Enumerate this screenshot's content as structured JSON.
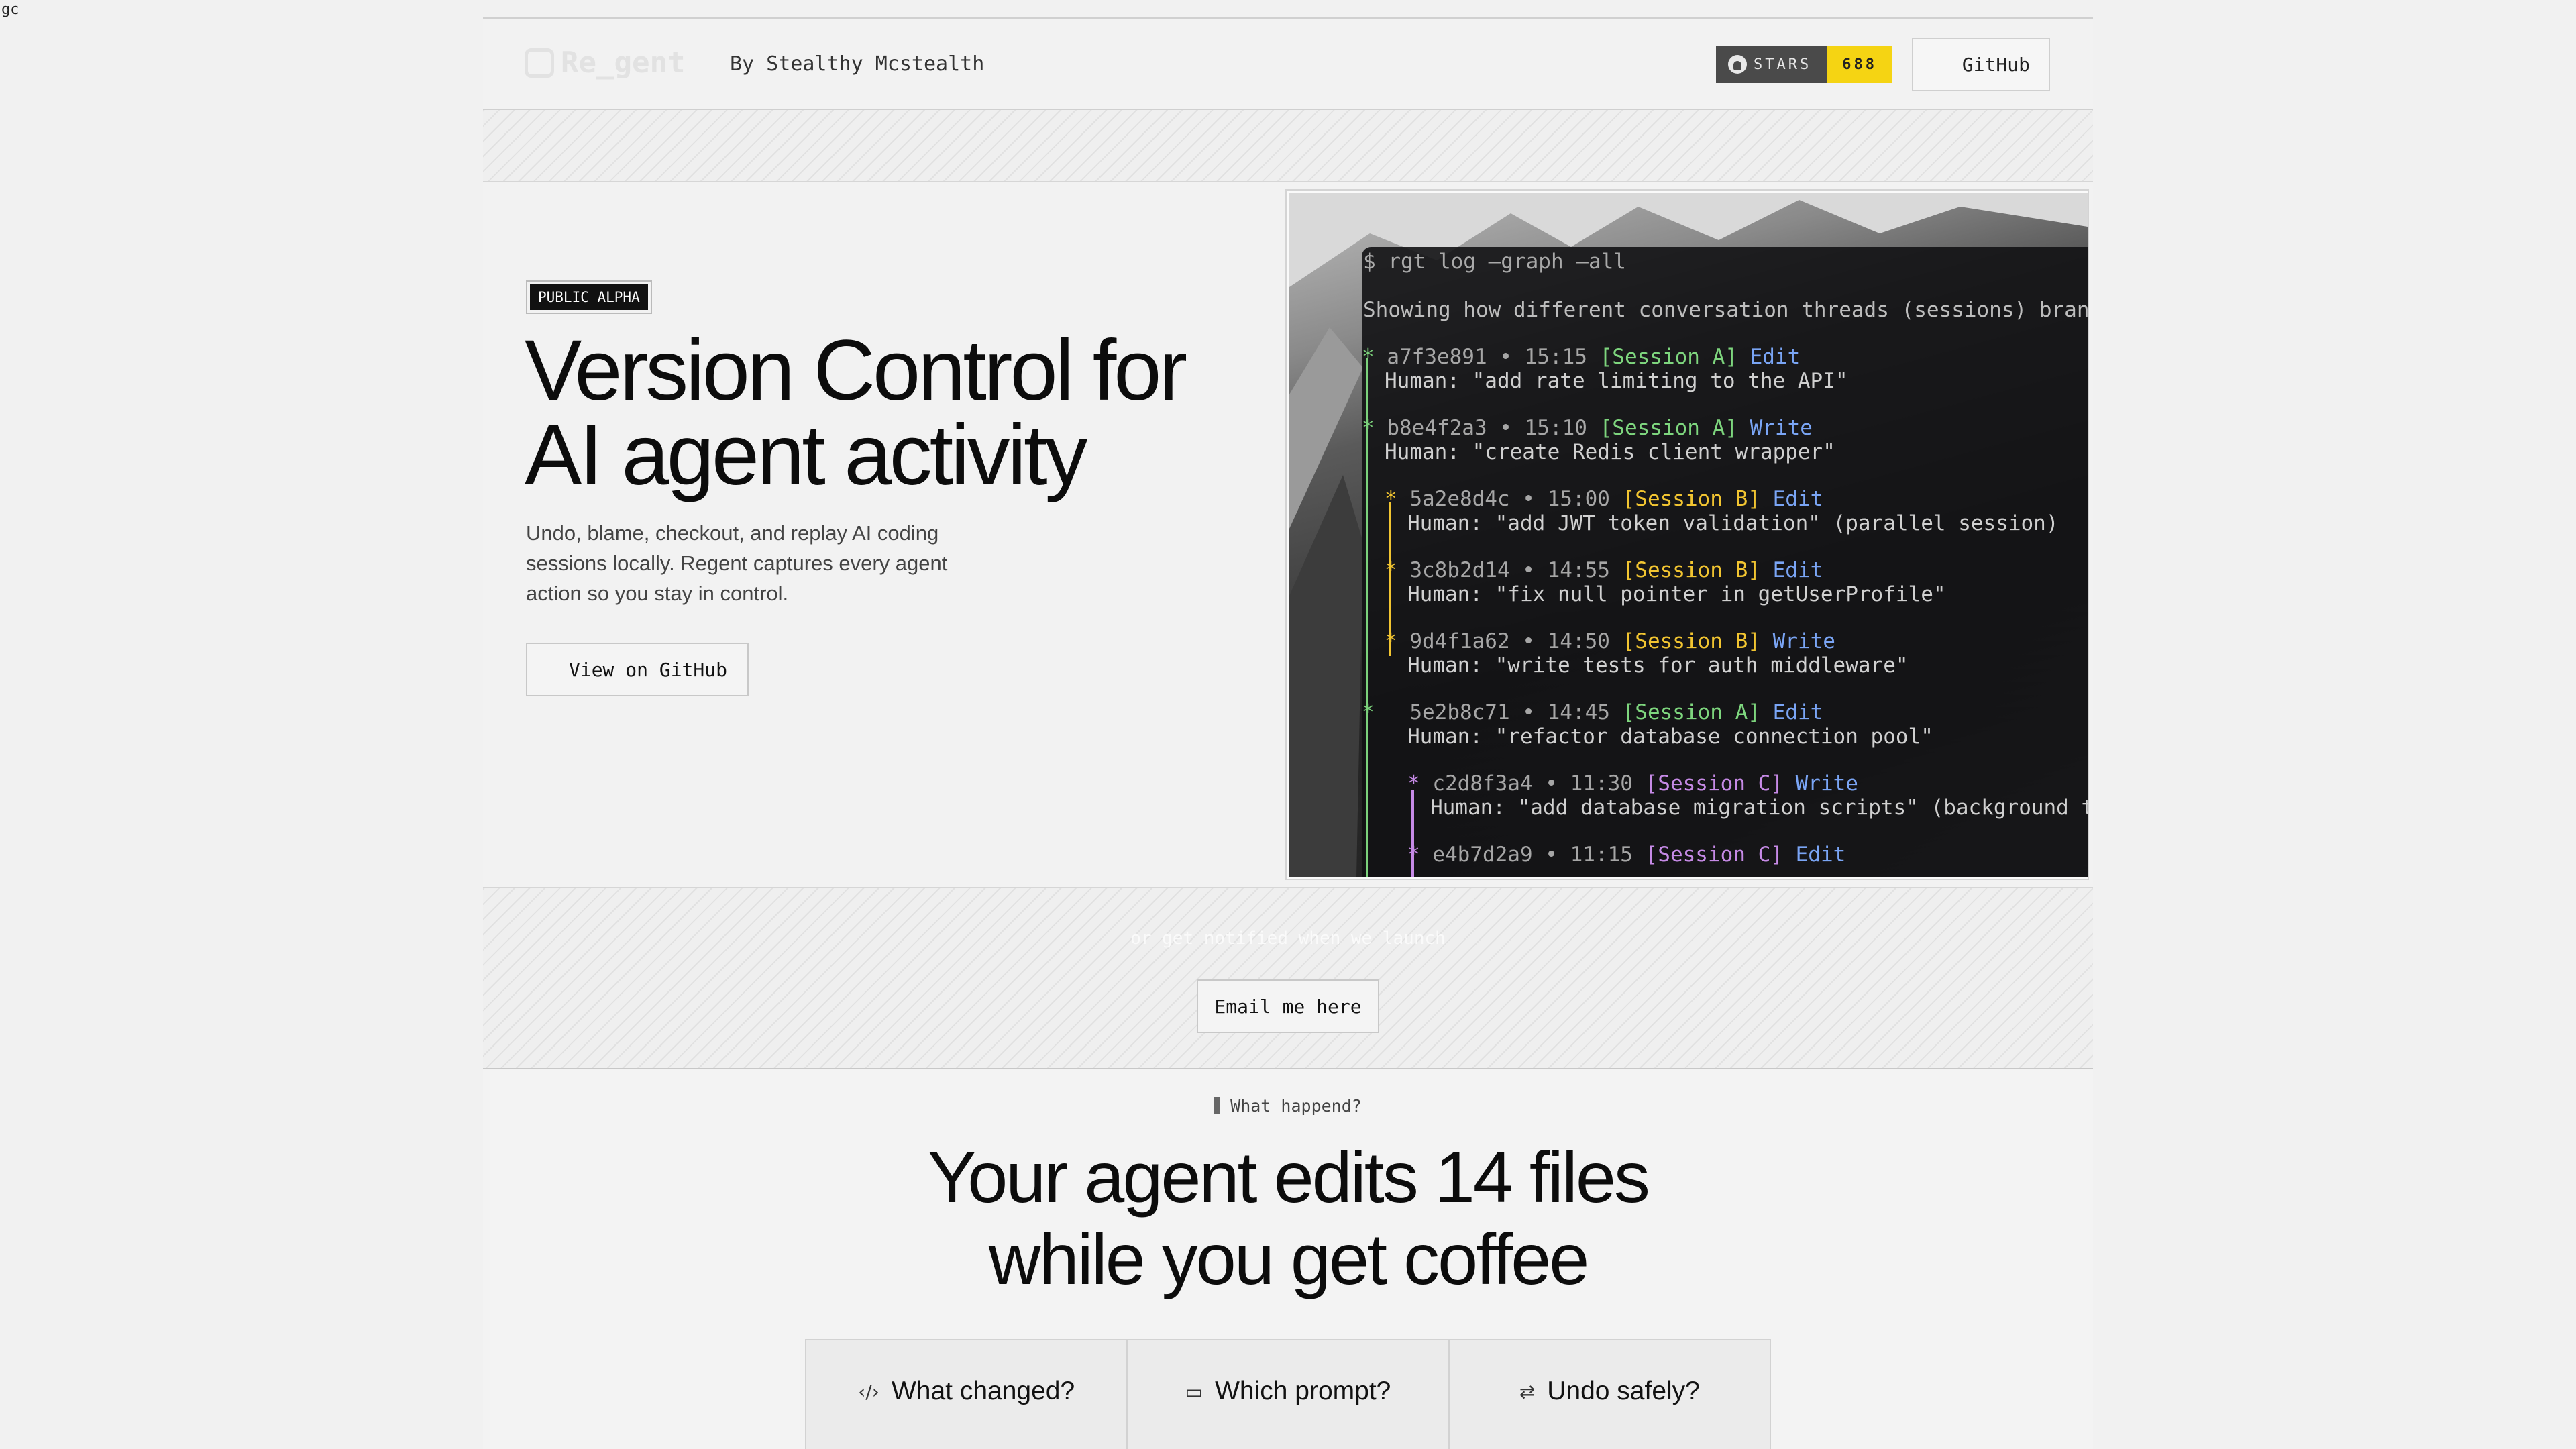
{
  "corner_text": "gc",
  "header": {
    "logo_text": "Re_gent",
    "byline": "By Stealthy Mcstealth",
    "stars_label": "STARS",
    "stars_count": "688",
    "github_button": "GitHub"
  },
  "hero": {
    "badge": "PUBLIC ALPHA",
    "title_line1": "Version Control for",
    "title_line2": "AI agent activity",
    "description": "Undo, blame, checkout, and replay AI coding sessions locally. Regent captures every agent action so you stay in control.",
    "cta": "View on GitHub"
  },
  "terminal": {
    "command": "$ rgt log —graph —all",
    "note": "Showing how different conversation threads (sessions) branch and",
    "commits": [
      {
        "hash": "a7f3e891",
        "time": "15:15",
        "session": "[Session A]",
        "action": "Edit",
        "human": "Human: \"add rate limiting to the API\""
      },
      {
        "hash": "b8e4f2a3",
        "time": "15:10",
        "session": "[Session A]",
        "action": "Write",
        "human": "Human: \"create Redis client wrapper\""
      },
      {
        "hash": "5a2e8d4c",
        "time": "15:00",
        "session": "[Session B]",
        "action": "Edit",
        "human": "Human: \"add JWT token validation\" (parallel session)"
      },
      {
        "hash": "3c8b2d14",
        "time": "14:55",
        "session": "[Session B]",
        "action": "Edit",
        "human": "Human: \"fix null pointer in getUserProfile\""
      },
      {
        "hash": "9d4f1a62",
        "time": "14:50",
        "session": "[Session B]",
        "action": "Write",
        "human": "Human: \"write tests for auth middleware\""
      },
      {
        "hash": "5e2b8c71",
        "time": "14:45",
        "session": "[Session A]",
        "action": "Edit",
        "human": "Human: \"refactor database connection pool\""
      },
      {
        "hash": "c2d8f3a4",
        "time": "11:30",
        "session": "[Session C]",
        "action": "Write",
        "human": "Human: \"add database migration scripts\" (background task)"
      },
      {
        "hash": "e4b7d2a9",
        "time": "11:15",
        "session": "[Session C]",
        "action": "Edit",
        "human": ""
      }
    ]
  },
  "waitlist": {
    "faint_text": "or get notified when we launch",
    "email_button": "Email me here"
  },
  "problem": {
    "kicker": "What happend?",
    "title_line1": "Your agent edits 14 files",
    "title_line2": "while you get coffee",
    "tabs": [
      {
        "icon": "code-icon",
        "label": "What changed?"
      },
      {
        "icon": "message-icon",
        "label": "Which prompt?"
      },
      {
        "icon": "undo-icon",
        "label": "Undo safely?"
      }
    ]
  },
  "colors": {
    "stars_accent": "#f5d413",
    "session_a": "#7ed67e",
    "session_b": "#f2c531",
    "session_c": "#c68ae6",
    "action": "#7aa5f5"
  }
}
